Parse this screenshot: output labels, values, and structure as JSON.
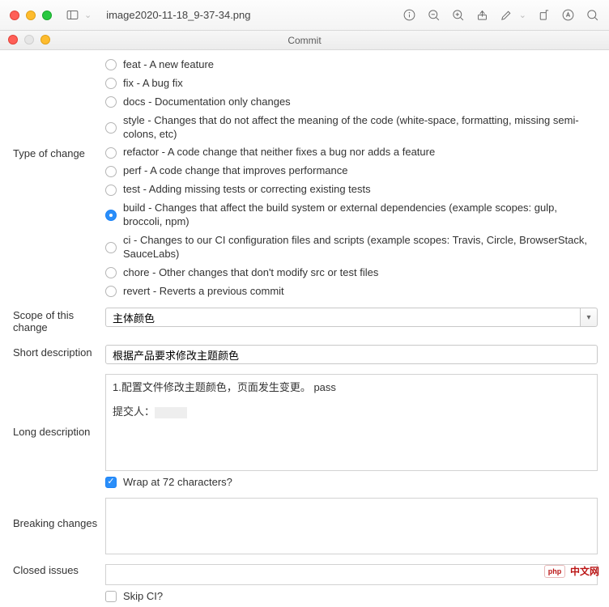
{
  "window": {
    "filename": "image2020-11-18_9-37-34.png"
  },
  "dialog": {
    "title": "Commit"
  },
  "form": {
    "type_of_change": {
      "label": "Type of change",
      "selected_index": 7,
      "options": [
        "feat - A new feature",
        "fix - A bug fix",
        "docs - Documentation only changes",
        "style - Changes that do not affect the meaning of the code (white-space, formatting, missing semi-colons, etc)",
        "refactor - A code change that neither fixes a bug nor adds a feature",
        "perf - A code change that improves performance",
        "test - Adding missing tests or correcting existing tests",
        "build - Changes that affect the build system or external dependencies (example scopes: gulp, broccoli, npm)",
        "ci - Changes to our CI configuration files and scripts (example scopes: Travis, Circle, BrowserStack, SauceLabs)",
        "chore - Other changes that don't modify src or test files",
        "revert - Reverts a previous commit"
      ]
    },
    "scope": {
      "label": "Scope of this change",
      "value": "主体颜色"
    },
    "short_desc": {
      "label": "Short description",
      "value": "根据产品要求修改主题颜色"
    },
    "long_desc": {
      "label": "Long description",
      "line1": "1.配置文件修改主题颜色，页面发生变更。 pass",
      "line2_prefix": "提交人：",
      "wrap_label": "Wrap at 72 characters?",
      "wrap_checked": true
    },
    "breaking": {
      "label": "Breaking changes",
      "value": ""
    },
    "closed": {
      "label": "Closed issues",
      "value": "",
      "skip_label": "Skip CI?",
      "skip_checked": false
    }
  },
  "watermark": {
    "logo": "php",
    "text": "中文网"
  }
}
